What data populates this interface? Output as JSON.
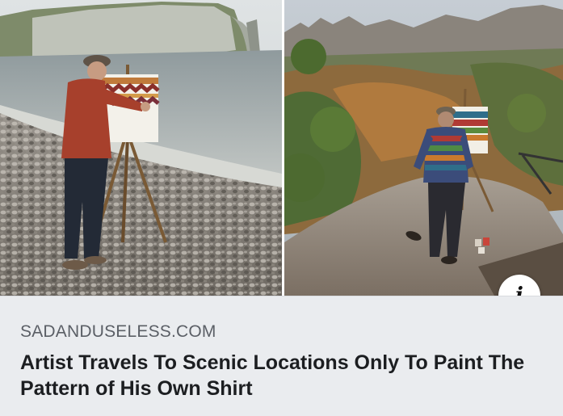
{
  "link_preview": {
    "domain": "SADANDUSELESS.COM",
    "headline": "Artist Travels To Scenic Locations Only To Paint The Pattern of His Own Shirt",
    "info_icon_glyph": "i"
  },
  "icons": {
    "info": "info-icon"
  },
  "colors": {
    "caption_background": "#eaecef",
    "domain_text": "#5b5f66",
    "headline_text": "#1c1e21"
  }
}
